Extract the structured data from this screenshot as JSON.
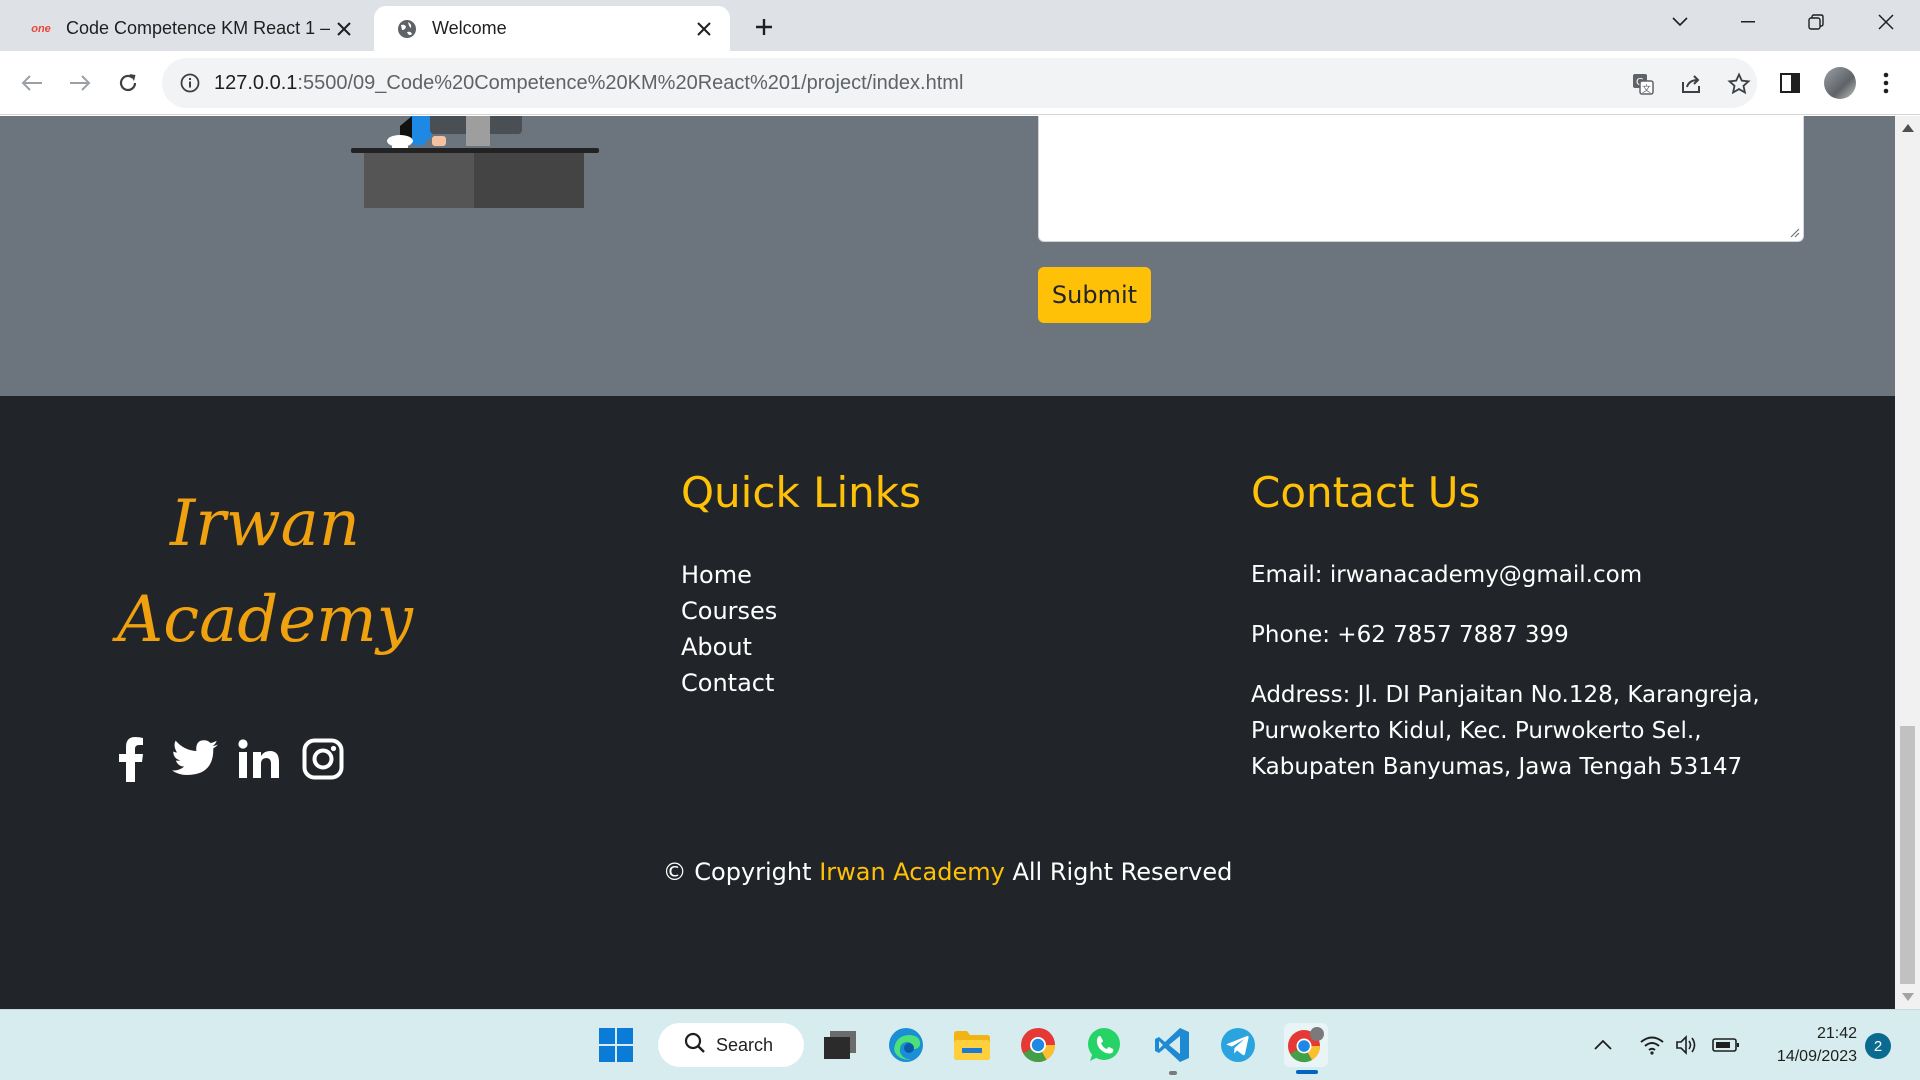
{
  "browser": {
    "tabs": [
      {
        "title": "Code Competence KM React 1 –",
        "favicon": "onedrive-one-icon",
        "favicon_text": "one"
      },
      {
        "title": "Welcome",
        "favicon": "globe-icon"
      }
    ],
    "url_host": "127.0.0.1",
    "url_rest": ":5500/09_Code%20Competence%20KM%20React%201/project/index.html"
  },
  "contact_form": {
    "submit_label": "Submit"
  },
  "footer": {
    "brand_line1": "Irwan",
    "brand_line2": "Academy",
    "social": [
      "facebook-icon",
      "twitter-icon",
      "linkedin-icon",
      "instagram-icon"
    ],
    "quick_links_title": "Quick Links",
    "quick_links": [
      "Home",
      "Courses",
      "About",
      "Contact"
    ],
    "contact_title": "Contact Us",
    "email": "Email: irwanacademy@gmail.com",
    "phone": "Phone: +62 7857 7887 399",
    "address": "Address: Jl. DI Panjaitan No.128, Karangreja, Purwokerto Kidul, Kec. Purwokerto Sel., Kabupaten Banyumas, Jawa Tengah 53147",
    "copyright_prefix": "© Copyright",
    "copyright_brand": "Irwan Academy",
    "copyright_suffix": "All Right Reserved"
  },
  "colors": {
    "accent": "#ffc107",
    "brand": "#f0a10f",
    "footer_bg": "#212529",
    "section_bg": "#6c757d"
  },
  "taskbar": {
    "search_label": "Search",
    "time": "21:42",
    "date": "14/09/2023",
    "notification_count": "2"
  }
}
